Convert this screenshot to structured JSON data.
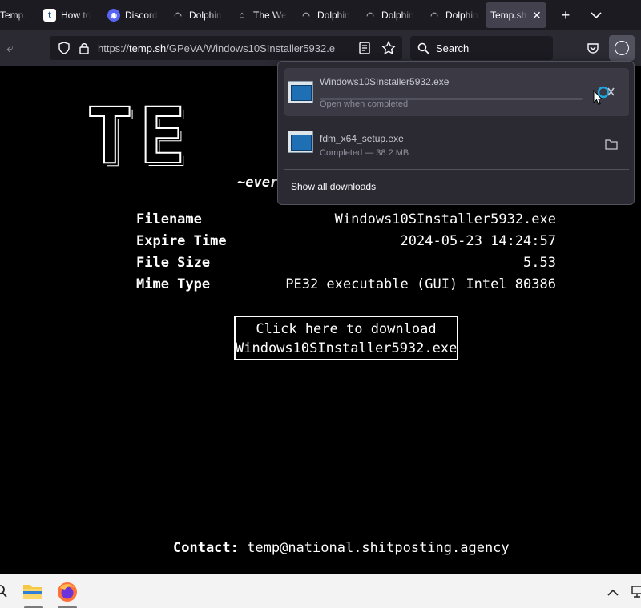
{
  "tabs": [
    {
      "label": "Temp.",
      "icon": "temp-site-icon"
    },
    {
      "label": "How to",
      "icon": "tumblr-icon"
    },
    {
      "label": "Discord",
      "icon": "discord-icon"
    },
    {
      "label": "Dolphin",
      "icon": "dolphin-icon"
    },
    {
      "label": "The We",
      "icon": "museum-icon"
    },
    {
      "label": "Dolphin",
      "icon": "dolphin-icon"
    },
    {
      "label": "Dolphin",
      "icon": "dolphin-icon"
    },
    {
      "label": "Dolphin",
      "icon": "dolphin-icon"
    },
    {
      "label": "Temp.sh",
      "icon": "none",
      "active": true
    }
  ],
  "navbar": {
    "url_prefix": "https://",
    "url_host": "temp.sh",
    "url_path": "/GPeVA/Windows10SInstaller5932.e",
    "search_placeholder": "Search"
  },
  "page": {
    "logo": "TE",
    "tagline": "~ever",
    "info": [
      {
        "key": "Filename",
        "value": "Windows10SInstaller5932.exe"
      },
      {
        "key": "Expire Time",
        "value": "2024-05-23 14:24:57"
      },
      {
        "key": "File Size",
        "value": "5.53"
      },
      {
        "key": "Mime Type",
        "value": "PE32 executable (GUI) Intel 80386"
      }
    ],
    "download_line1": "Click here to download",
    "download_line2": "Windows10SInstaller5932.exe",
    "contact_label": "Contact:",
    "contact_email": "temp@national.shitposting.agency"
  },
  "downloads": {
    "items": [
      {
        "name": "Windows10SInstaller5932.exe",
        "status": "Open when completed",
        "progress": 0.0
      },
      {
        "name": "fdm_x64_setup.exe",
        "status": "Completed — 38.2 MB"
      }
    ],
    "show_all": "Show all downloads"
  },
  "colors": {
    "tabbar": "#1c1b22",
    "navbar": "#2b2a33",
    "accent": "#0df",
    "panel": "#2b2a33"
  }
}
